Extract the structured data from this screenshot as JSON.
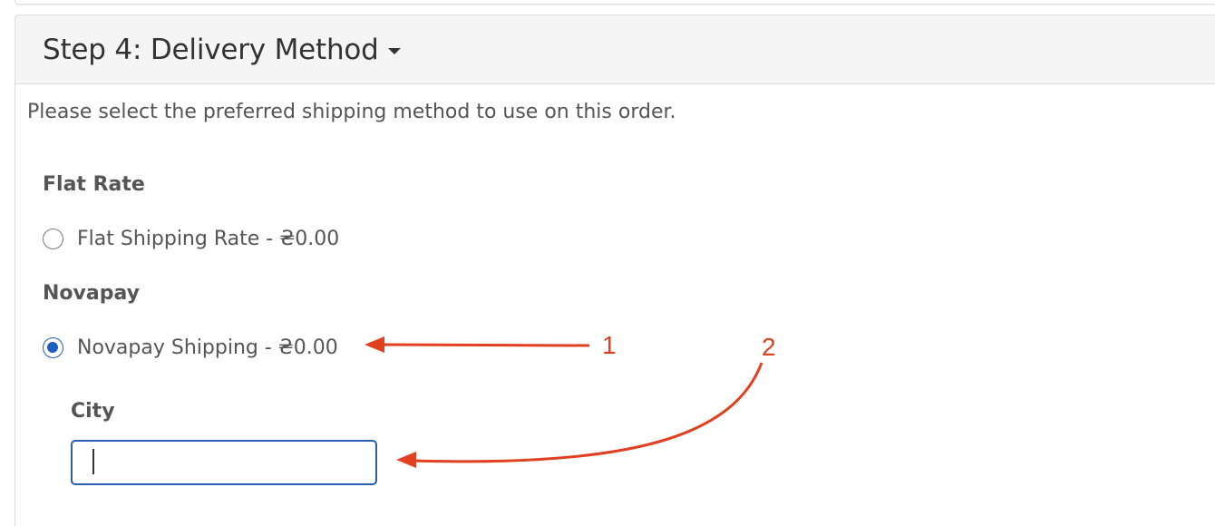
{
  "panel": {
    "title": "Step 4: Delivery Method"
  },
  "intro_text": "Please select the preferred shipping method to use on this order.",
  "shipping_groups": [
    {
      "title": "Flat Rate",
      "option_label": "Flat Shipping Rate - ₴0.00",
      "selected": false
    },
    {
      "title": "Novapay",
      "option_label": "Novapay Shipping - ₴0.00",
      "selected": true
    }
  ],
  "city_field": {
    "label": "City",
    "value": ""
  },
  "annotations": {
    "label_1": "1",
    "label_2": "2",
    "color": "#e0401f"
  },
  "colors": {
    "accent": "#1f5fbf",
    "text": "#555555",
    "heading_bg": "#f5f5f5"
  }
}
